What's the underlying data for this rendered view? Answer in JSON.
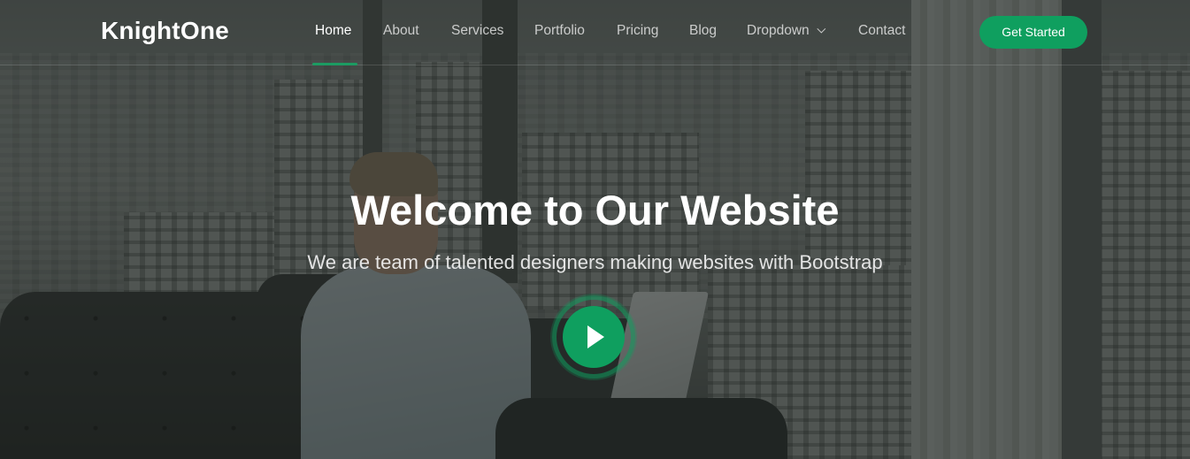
{
  "brand": {
    "name": "KnightOne"
  },
  "nav": {
    "items": [
      {
        "label": "Home",
        "active": true
      },
      {
        "label": "About"
      },
      {
        "label": "Services"
      },
      {
        "label": "Portfolio"
      },
      {
        "label": "Pricing"
      },
      {
        "label": "Blog"
      },
      {
        "label": "Dropdown",
        "icon": "chevron-down-icon"
      },
      {
        "label": "Contact"
      }
    ],
    "cta_label": "Get Started"
  },
  "hero": {
    "title": "Welcome to Our Website",
    "subtitle": "We are team of talented designers making websites with Bootstrap",
    "play_icon": "play-icon"
  },
  "colors": {
    "accent": "#0f9f5f",
    "text": "#ffffff"
  }
}
